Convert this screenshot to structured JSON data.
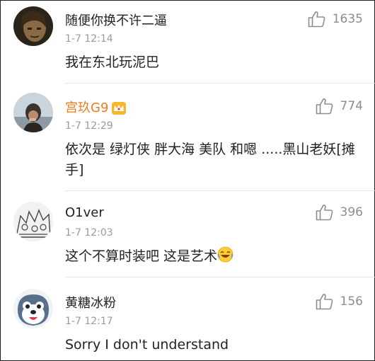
{
  "comments": [
    {
      "username": "随便你换不许二逼",
      "time": "1-7 12:14",
      "likes": "1635",
      "text": "我在东北玩泥巴"
    },
    {
      "username": "宫玖G9",
      "time": "1-7 12:29",
      "likes": "774",
      "text": "依次是 绿灯侠 胖大海 美队 和嗯 .....黑山老妖[摊手]"
    },
    {
      "username": "O1ver",
      "time": "1-7 12:03",
      "likes": "396",
      "text": "这个不算时装吧 这是艺术"
    },
    {
      "username": "黄糖冰粉",
      "time": "1-7 12:17",
      "likes": "156",
      "text": "Sorry I don't understand"
    }
  ],
  "colors": {
    "vip_name": "#f07b1f",
    "time": "#9a9a9a",
    "like": "#8d8d8d"
  },
  "icons": [
    "thumbs-up-icon",
    "crown-badge-icon",
    "laughing-emoji-icon"
  ]
}
